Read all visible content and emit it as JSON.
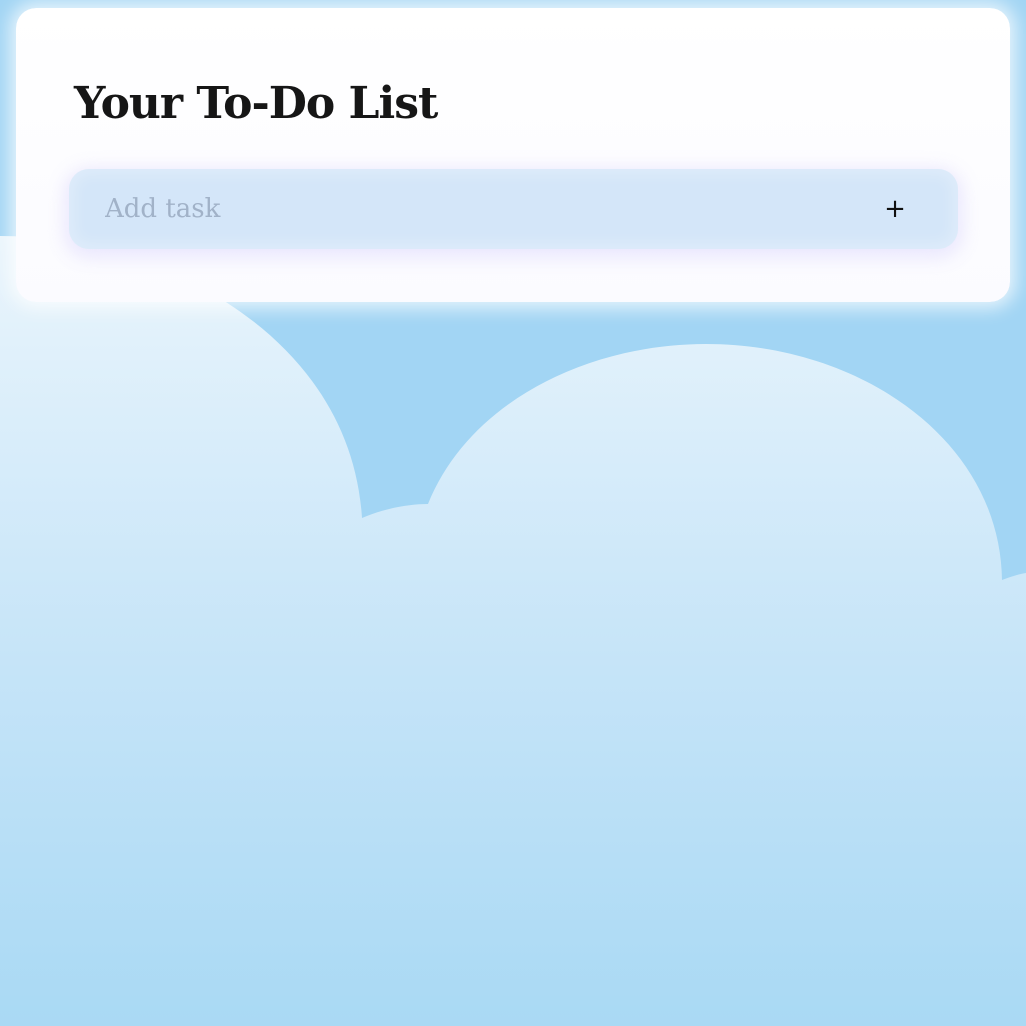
{
  "page": {
    "title": "Your To-Do List"
  },
  "add_task": {
    "placeholder": "Add task",
    "value": "",
    "button_label": "+"
  },
  "colors": {
    "sky": "#a2d5f4",
    "cloud_top": "#eaf5fc",
    "cloud_bottom": "#aedcf5",
    "card": "#ffffff",
    "input_background": "#d4e6f9",
    "placeholder_text": "#a1b2c8",
    "title_text": "#161616"
  }
}
